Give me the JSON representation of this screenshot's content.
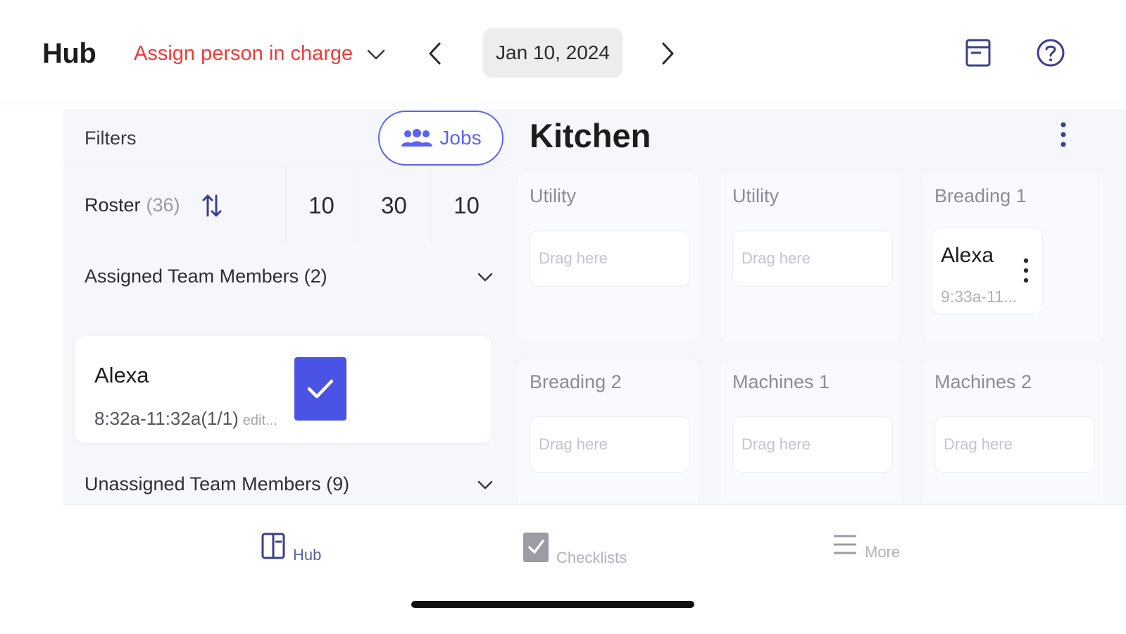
{
  "header": {
    "title": "Hub",
    "assign_label": "Assign person in charge",
    "date": "Jan 10, 2024",
    "icons": [
      "chevron-left-icon",
      "chevron-right-icon",
      "report-icon",
      "help-icon"
    ]
  },
  "filters": {
    "label": "Filters",
    "jobs_button": "Jobs"
  },
  "roster": {
    "label": "Roster",
    "count": "(36)",
    "columns": [
      "10",
      "30",
      "10"
    ]
  },
  "assigned": {
    "header": "Assigned Team Members (2)",
    "members": [
      {
        "name": "Alexa",
        "time": "8:32a-11:32a(1/1)",
        "edit": "edit...",
        "checked": true
      }
    ]
  },
  "unassigned": {
    "header": "Unassigned Team Members (9)"
  },
  "kitchen": {
    "title": "Kitchen",
    "drag_placeholder": "Drag here",
    "jobs": [
      {
        "title": "Utility"
      },
      {
        "title": "Utility"
      },
      {
        "title": "Breading 1",
        "assignee": {
          "name": "Alexa",
          "time": "9:33a-11..."
        }
      },
      {
        "title": "Breading 2"
      },
      {
        "title": "Machines 1"
      },
      {
        "title": "Machines 2"
      }
    ]
  },
  "tabs": [
    {
      "label": "Hub",
      "icon": "hub-icon",
      "active": true
    },
    {
      "label": "Checklists",
      "icon": "checklist-icon",
      "active": false
    },
    {
      "label": "More",
      "icon": "menu-icon",
      "active": false
    }
  ],
  "colors": {
    "accent": "#4b53e6",
    "alert": "#ef3b3b"
  }
}
